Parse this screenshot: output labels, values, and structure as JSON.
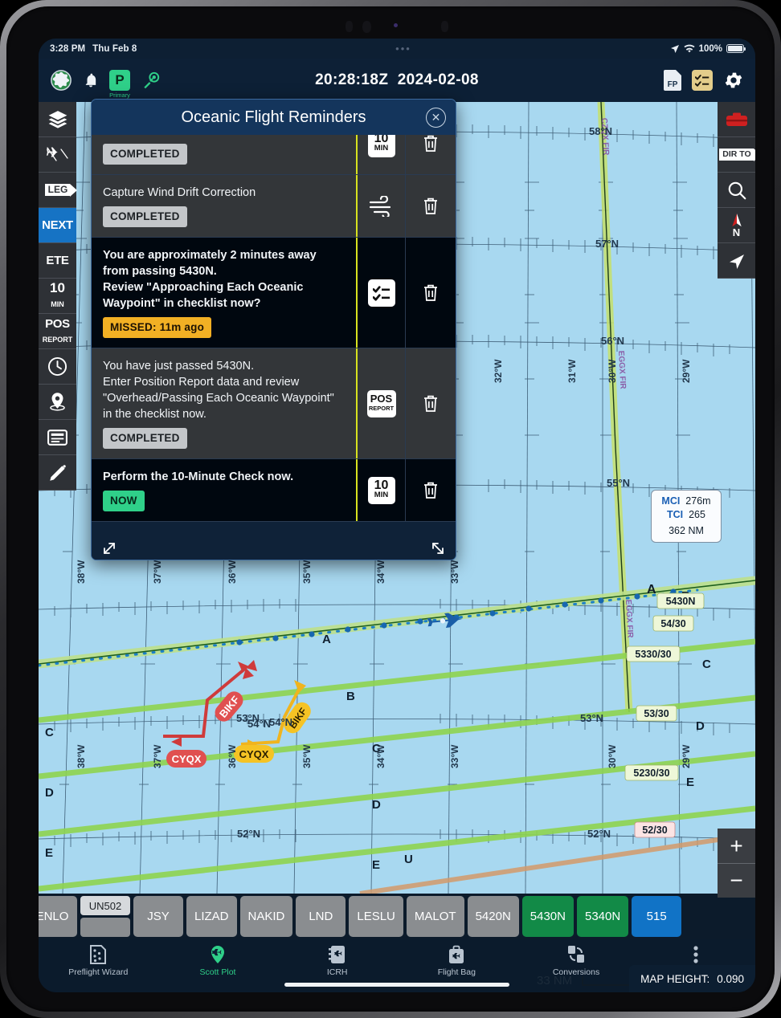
{
  "status_bar": {
    "time": "3:28 PM",
    "date": "Thu Feb 8",
    "center_dots": "•••",
    "battery_percent": "100%"
  },
  "app_header": {
    "zulu_time": "20:28:18Z",
    "date": "2024-02-08",
    "globe_icon": "globe-icon",
    "bell_icon": "bell-icon",
    "primary_badge": "P",
    "primary_label": "Primary",
    "satellite_icon": "satellite-icon",
    "fp_doc_label": "FP",
    "checklist_icon": "checklist-icon",
    "gear_icon": "gear-icon"
  },
  "left_toolbar": [
    {
      "name": "layers",
      "label": "",
      "icon": "layers-icon",
      "active": false
    },
    {
      "name": "aircraft-traffic",
      "label": "",
      "icon": "aircraft-traffic-icon",
      "active": false
    },
    {
      "name": "leg",
      "label": "LEG",
      "icon": "leg-arrow-icon",
      "active": false
    },
    {
      "name": "next",
      "label": "NEXT",
      "icon": "",
      "active": true
    },
    {
      "name": "ete",
      "label": "ETE",
      "icon": "",
      "active": false
    },
    {
      "name": "ten-minute",
      "label": "10",
      "sub": "MIN",
      "icon": "",
      "active": false
    },
    {
      "name": "pos-report",
      "label": "POS",
      "sub": "REPORT",
      "icon": "",
      "active": false
    },
    {
      "name": "clock",
      "label": "",
      "icon": "clock-icon",
      "active": false
    },
    {
      "name": "waypoint-pin",
      "label": "",
      "icon": "pin-icon",
      "active": false
    },
    {
      "name": "notes",
      "label": "",
      "icon": "notes-icon",
      "active": false
    },
    {
      "name": "draw",
      "label": "",
      "icon": "pencil-icon",
      "active": false
    }
  ],
  "right_toolbar": [
    {
      "name": "flight-bag",
      "icon": "briefcase-icon"
    },
    {
      "name": "direct-to",
      "label": "DIR TO",
      "icon": "dir-to-arrow-icon"
    },
    {
      "name": "search",
      "icon": "search-icon"
    },
    {
      "name": "north-up",
      "label": "N",
      "icon": "compass-north-icon"
    },
    {
      "name": "locate-me",
      "icon": "navigation-arrow-icon"
    }
  ],
  "zoom_controls": {
    "zoom_in": "+",
    "zoom_out": "−"
  },
  "map": {
    "height_label": "MAP HEIGHT:",
    "height_value": "0.090",
    "scale_label": "33 NM",
    "info_box": {
      "mci_key": "MCI",
      "mci_value": "276m",
      "tci_key": "TCI",
      "tci_value": "265",
      "distance": "362 NM"
    },
    "lat_labels": [
      "58°N",
      "57°N",
      "56°N",
      "55°N",
      "54°N",
      "53°N",
      "52°N"
    ],
    "lon_labels": [
      "38°W",
      "37°W",
      "36°W",
      "35°W",
      "34°W",
      "33°W",
      "32°W",
      "31°W",
      "30°W",
      "29°W"
    ],
    "fir_labels": [
      "CZQX FIR",
      "EGGX FIR"
    ],
    "alternate_labels": [
      {
        "text": "BIKF",
        "color": "#d94040"
      },
      {
        "text": "CYQX",
        "color": "#d94040"
      },
      {
        "text": "BIKF",
        "color": "#f5c324"
      },
      {
        "text": "CYQX",
        "color": "#f5c324"
      }
    ],
    "route_point_labels": [
      "5430N",
      "54/30",
      "5330/30",
      "53/30",
      "5230/30",
      "52/30"
    ],
    "track_letters": [
      "A",
      "B",
      "C",
      "D",
      "E",
      "U"
    ]
  },
  "modal": {
    "title": "Oceanic Flight Reminders",
    "close_icon": "close-icon",
    "reminders": [
      {
        "text": "",
        "status": "COMPLETED",
        "status_type": "completed",
        "icon": "ten-minute-icon",
        "icon_label": "10",
        "icon_sub": "MIN",
        "row_style": "grey",
        "bold": false,
        "partial": true
      },
      {
        "text": "Capture Wind Drift Correction",
        "status": "COMPLETED",
        "status_type": "completed",
        "icon": "wind-icon",
        "row_style": "grey",
        "bold": false
      },
      {
        "text": "You are approximately 2 minutes away from passing 5430N.\nReview \"Approaching Each Oceanic Waypoint\" in checklist now?",
        "status": "MISSED:  11m ago",
        "status_type": "missed",
        "icon": "checklist-icon",
        "row_style": "dark",
        "bold": true
      },
      {
        "text": "You have just passed 5430N.\nEnter Position Report data and review \"Overhead/Passing Each Oceanic Waypoint\" in the checklist now.",
        "status": "COMPLETED",
        "status_type": "completed",
        "icon": "pos-report-icon",
        "icon_label": "POS",
        "icon_sub": "REPORT",
        "row_style": "grey",
        "bold": false
      },
      {
        "text": "Perform the 10-Minute Check now.",
        "status": "NOW",
        "status_type": "now",
        "icon": "ten-minute-icon",
        "icon_label": "10",
        "icon_sub": "MIN",
        "row_style": "dark",
        "bold": true
      }
    ],
    "delete_icon": "trash-icon",
    "resize_icon_left": "resize-handle-icon",
    "resize_icon_right": "resize-handle-icon"
  },
  "waypoint_strip": [
    {
      "label": "ENLO",
      "style": "grey"
    },
    {
      "label": "UN502",
      "style": "stack"
    },
    {
      "label": "JSY",
      "style": "grey"
    },
    {
      "label": "LIZAD",
      "style": "grey"
    },
    {
      "label": "NAKID",
      "style": "grey"
    },
    {
      "label": "LND",
      "style": "grey"
    },
    {
      "label": "LESLU",
      "style": "grey"
    },
    {
      "label": "MALOT",
      "style": "grey"
    },
    {
      "label": "5420N",
      "style": "grey"
    },
    {
      "label": "5430N",
      "style": "green"
    },
    {
      "label": "5340N",
      "style": "green"
    },
    {
      "label": "515",
      "style": "blue"
    }
  ],
  "tab_bar": [
    {
      "label": "Preflight Wizard",
      "icon": "preflight-wizard-icon",
      "active": false
    },
    {
      "label": "Scott Plot",
      "icon": "map-pin-plane-icon",
      "active": true
    },
    {
      "label": "ICRH",
      "icon": "icrh-icon",
      "active": false
    },
    {
      "label": "Flight Bag",
      "icon": "flight-bag-icon",
      "active": false
    },
    {
      "label": "Conversions",
      "icon": "conversions-icon",
      "active": false
    },
    {
      "label": "More",
      "icon": "more-dots-icon",
      "active": false
    }
  ],
  "colors": {
    "accent_blue": "#1673c4",
    "green": "#2fd089",
    "amber": "#f2b024",
    "map_water": "#a8d8f0",
    "header_bg": "#0d2036",
    "yellow_divider": "#d8e21f"
  }
}
